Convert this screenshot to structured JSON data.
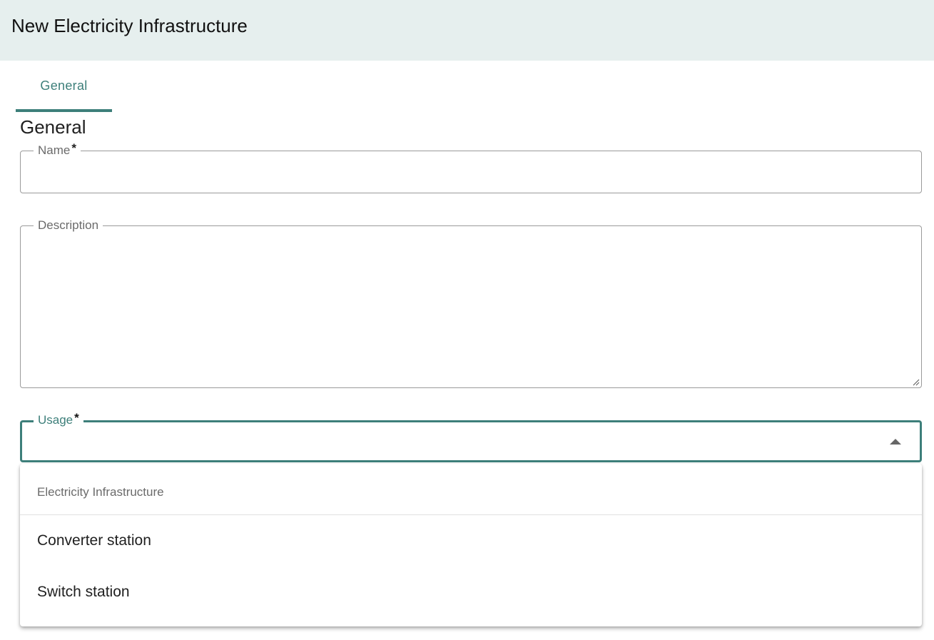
{
  "header": {
    "title": "New Electricity Infrastructure"
  },
  "tabs": [
    {
      "label": "General",
      "active": true
    }
  ],
  "section": {
    "title": "General"
  },
  "form": {
    "name": {
      "label": "Name",
      "required_marker": "*",
      "value": ""
    },
    "description": {
      "label": "Description",
      "value": ""
    },
    "usage": {
      "label": "Usage",
      "required_marker": "*",
      "value": "",
      "expanded": true,
      "dropdown": {
        "group_label": "Electricity Infrastructure",
        "options": [
          "Converter station",
          "Switch station"
        ]
      }
    }
  },
  "colors": {
    "header_bg": "#e6efee",
    "accent": "#3d7f7a",
    "border": "#9a9a9a"
  },
  "icons": {
    "usage_toggle": "caret-up-icon",
    "textarea_resize": "resize-grip-icon"
  }
}
